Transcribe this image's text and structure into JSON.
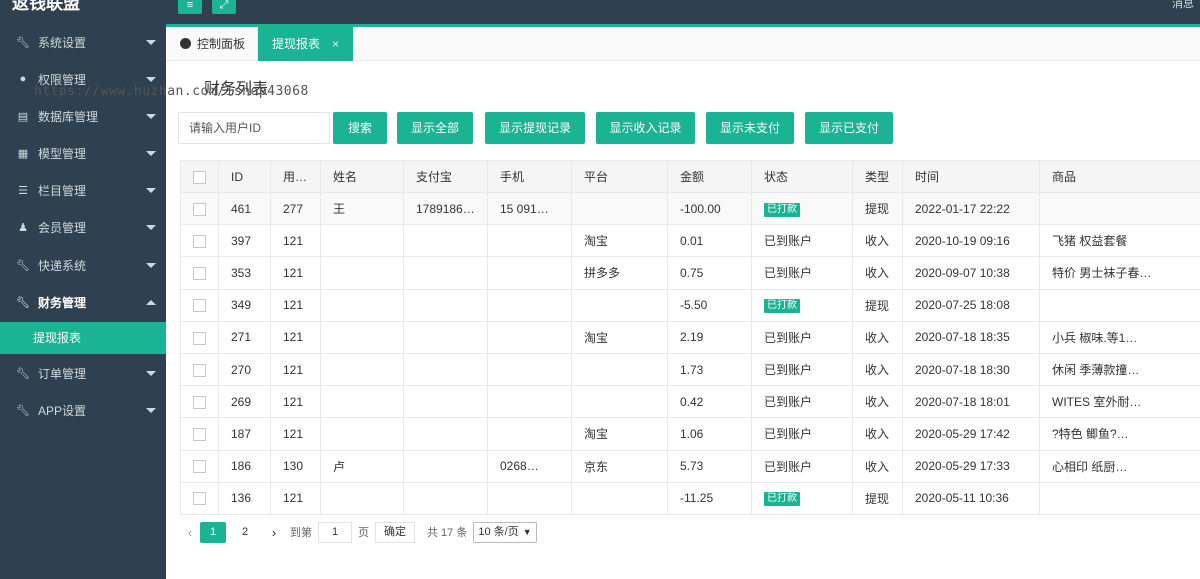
{
  "app": {
    "brand": "返钱联盟",
    "user_snippet": "消息"
  },
  "topbar": {
    "menu_toggle_icon": "≡",
    "fullscreen_icon": "⤢"
  },
  "sidebar": {
    "items": [
      {
        "label": "系统设置",
        "icon": "wrench-icon"
      },
      {
        "label": "权限管理",
        "icon": "globe-icon"
      },
      {
        "label": "数据库管理",
        "icon": "database-icon"
      },
      {
        "label": "模型管理",
        "icon": "grid-icon"
      },
      {
        "label": "栏目管理",
        "icon": "list-icon"
      },
      {
        "label": "会员管理",
        "icon": "user-icon"
      },
      {
        "label": "快递系统",
        "icon": "wrench-icon"
      },
      {
        "label": "财务管理",
        "icon": "wrench-icon"
      },
      {
        "label": "订单管理",
        "icon": "wrench-icon"
      },
      {
        "label": "APP设置",
        "icon": "wrench-icon"
      }
    ],
    "submenu": {
      "label": "提现报表"
    }
  },
  "tabs": {
    "dashboard": "控制面板",
    "report": "提现报表",
    "close": "×"
  },
  "page": {
    "title": "财务列表",
    "watermark": "https://www.huzhan.com/ishop43068"
  },
  "search": {
    "placeholder": "请输入用户ID"
  },
  "buttons": {
    "search": "搜索",
    "all": "显示全部",
    "withdraw": "显示提现记录",
    "income": "显示收入记录",
    "unpaid": "显示未支付",
    "paid": "显示已支付"
  },
  "table": {
    "headers": [
      "",
      "ID",
      "用…",
      "姓名",
      "支付宝",
      "手机",
      "平台",
      "金额",
      "状态",
      "类型",
      "时间",
      "商品"
    ],
    "rows": [
      [
        "",
        "461",
        "277",
        "王",
        "1789186…",
        "15 091…",
        "",
        "-100.00",
        "已打款",
        "提现",
        "2022-01-17 22:22",
        ""
      ],
      [
        "",
        "397",
        "121",
        "",
        "",
        "",
        "淘宝",
        "0.01",
        "已到账户",
        "收入",
        "2020-10-19 09:16",
        "飞猪 权益套餐"
      ],
      [
        "",
        "353",
        "121",
        "",
        "",
        "",
        "拼多多",
        "0.75",
        "已到账户",
        "收入",
        "2020-09-07 10:38",
        "特价 男士袜子春…"
      ],
      [
        "",
        "349",
        "121",
        "",
        "",
        "",
        "",
        "-5.50",
        "已打款",
        "提现",
        "2020-07-25 18:08",
        ""
      ],
      [
        "",
        "271",
        "121",
        "",
        "",
        "",
        "淘宝",
        "2.19",
        "已到账户",
        "收入",
        "2020-07-18 18:35",
        "小兵 椒味.等1…"
      ],
      [
        "",
        "270",
        "121",
        "",
        "",
        "",
        "",
        "1.73",
        "已到账户",
        "收入",
        "2020-07-18 18:30",
        "休闲 季薄款撞…"
      ],
      [
        "",
        "269",
        "121",
        "",
        "",
        "",
        "",
        "0.42",
        "已到账户",
        "收入",
        "2020-07-18 18:01",
        "WITES 室外耐…"
      ],
      [
        "",
        "187",
        "121",
        "",
        "",
        "",
        "淘宝",
        "1.06",
        "已到账户",
        "收入",
        "2020-05-29 17:42",
        "?特色 鲫鱼?…"
      ],
      [
        "",
        "186",
        "130",
        "卢",
        "",
        "0268…",
        "京东",
        "5.73",
        "已到账户",
        "收入",
        "2020-05-29 17:33",
        "心相印 纸厨…"
      ],
      [
        "",
        "136",
        "121",
        "",
        "",
        "",
        "",
        "-11.25",
        "已打款",
        "提现",
        "2020-05-11 10:36",
        ""
      ]
    ]
  },
  "pagination": {
    "prev": "‹",
    "page1": "1",
    "page2": "2",
    "next": "›",
    "goto": "到第",
    "input_value": "1",
    "page_unit": "页",
    "confirm": "确定",
    "total": "共 17 条",
    "per_page": "10 条/页"
  }
}
